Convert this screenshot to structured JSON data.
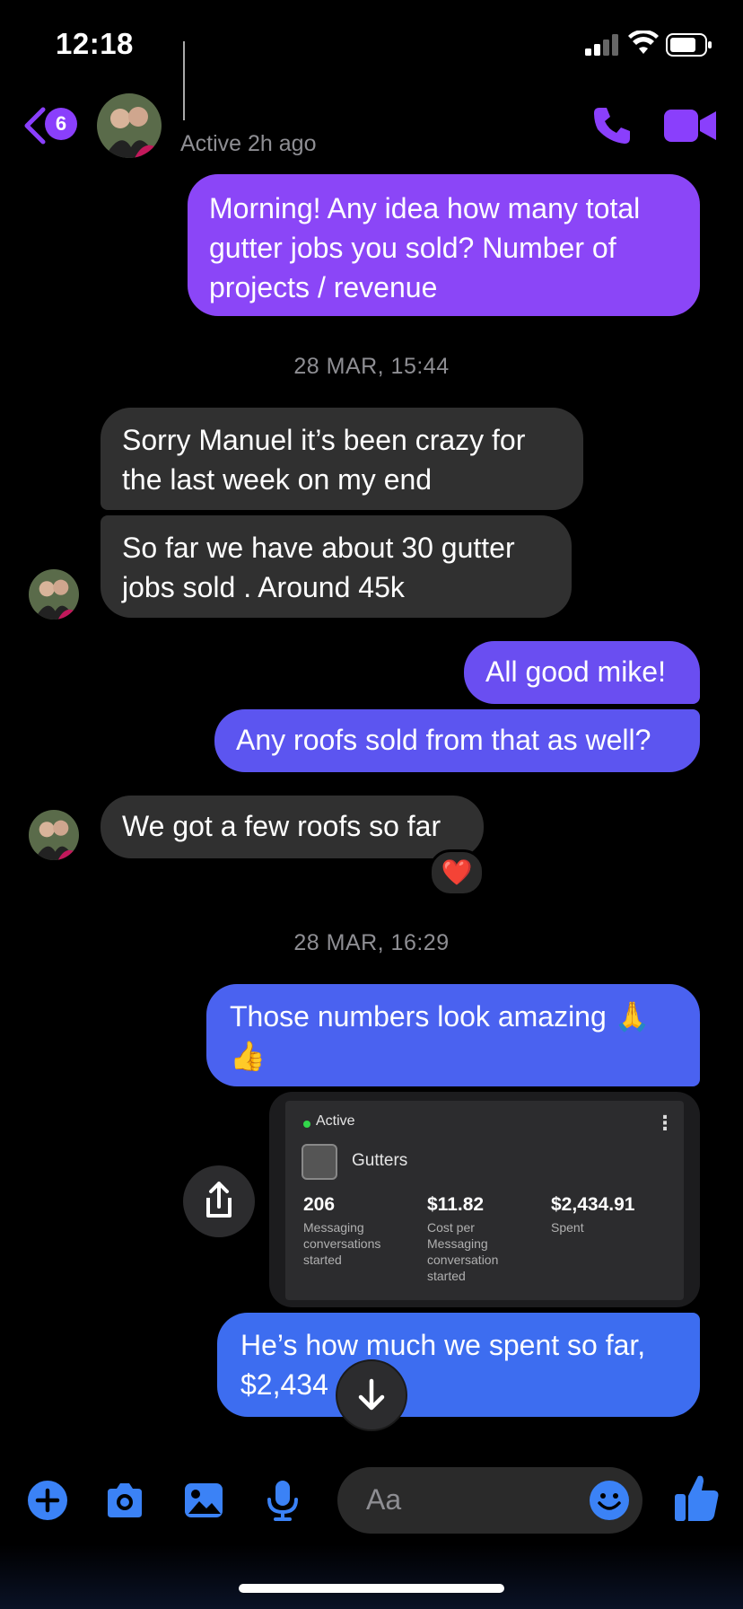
{
  "status_bar": {
    "time": "12:18"
  },
  "header": {
    "back_badge": "6",
    "active_status": "Active 2h ago"
  },
  "colors": {
    "accent": "#8a3ffc",
    "bubble_out_top": "#8b46f7",
    "bubble_out_mid": "#6a4ef1",
    "bubble_out_bottom": "#3d6df0",
    "bubble_in": "#303030"
  },
  "messages": {
    "m1": "Morning! Any idea how many total gutter jobs you sold? Number of projects / revenue",
    "ts1": "28 MAR, 15:44",
    "m2": "Sorry Manuel it’s been crazy for the last week on my end",
    "m3": "So far we have about 30 gutter jobs sold . Around 45k",
    "m4": "All good mike!",
    "m5": "Any roofs sold from that as well?",
    "m6": "We got a few roofs so far",
    "m6_reaction": "❤️",
    "ts2": "28 MAR, 16:29",
    "m7": "Those numbers look amazing 🙏 👍",
    "m8": "He’s how much we spent so far, $2,434"
  },
  "ad_card": {
    "status": "Active",
    "title": "Gutters",
    "metrics": [
      {
        "value": "206",
        "label": "Messaging conversations started"
      },
      {
        "value": "$11.82",
        "label": "Cost per Messaging conversation started"
      },
      {
        "value": "$2,434.91",
        "label": "Spent"
      }
    ]
  },
  "composer": {
    "placeholder": "Aa"
  }
}
